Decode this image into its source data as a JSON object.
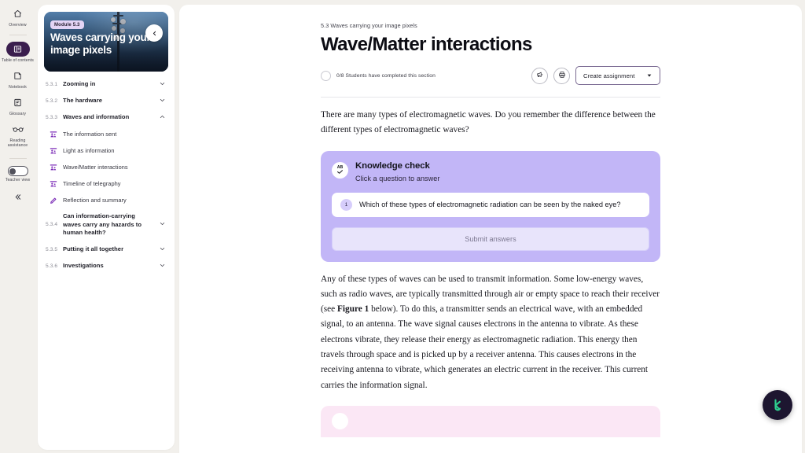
{
  "rail": {
    "items": [
      {
        "label": "Overview",
        "icon": "home-icon",
        "active": false
      },
      {
        "label": "Table of contents",
        "icon": "table-of-contents-icon",
        "active": true
      },
      {
        "label": "Notebook",
        "icon": "notebook-icon",
        "active": false
      },
      {
        "label": "Glossary",
        "icon": "glossary-icon",
        "active": false
      },
      {
        "label": "Reading assistance",
        "icon": "reading-assistance-icon",
        "active": false
      }
    ],
    "teacher_view": {
      "label": "Teacher view",
      "state": "off"
    },
    "collapse": {
      "icon": "chevron-double-left-icon"
    }
  },
  "toc": {
    "hero": {
      "module_chip": "Module 5.3",
      "title": "Waves carrying your image pixels",
      "back_icon": "chevron-left-icon"
    },
    "sections": [
      {
        "number": "5.3.1",
        "label": "Zooming in",
        "chevron": "chevron-down-icon",
        "expanded": false
      },
      {
        "number": "5.3.2",
        "label": "The hardware",
        "chevron": "chevron-down-icon",
        "expanded": false
      },
      {
        "number": "5.3.3",
        "label": "Waves and information",
        "chevron": "chevron-up-icon",
        "expanded": true
      }
    ],
    "sub_items": [
      {
        "label": "The information sent",
        "icon": "presentation-icon"
      },
      {
        "label": "Light as information",
        "icon": "presentation-icon"
      },
      {
        "label": "Wave/Matter interactions",
        "icon": "presentation-icon"
      },
      {
        "label": "Timeline of telegraphy",
        "icon": "presentation-icon"
      },
      {
        "label": "Reflection and summary",
        "icon": "pencil-icon"
      }
    ],
    "sections_after": [
      {
        "number": "5.3.4",
        "label": "Can information-carrying waves carry any hazards to human health?",
        "chevron": "chevron-down-icon"
      },
      {
        "number": "5.3.5",
        "label": "Putting it all together",
        "chevron": "chevron-down-icon"
      },
      {
        "number": "5.3.6",
        "label": "Investigations",
        "chevron": "chevron-down-icon"
      }
    ]
  },
  "header": {
    "breadcrumb": "5.3 Waves carrying your image pixels",
    "title": "Wave/Matter interactions",
    "progress_text": "0/8 Students have completed this section",
    "announce_icon": "megaphone-icon",
    "print_icon": "printer-icon",
    "create_assignment_label": "Create assignment",
    "create_assignment_chevron": "chevron-down-icon"
  },
  "content": {
    "paragraph_1": "There are many types of electromagnetic waves. Do you remember the difference between the different types of electromagnetic waves?",
    "paragraph_2_part1": "Any of these types of waves can be used to transmit information. Some low-energy waves, such as radio waves, are typically transmitted through air or empty space to reach their receiver (see ",
    "paragraph_2_bold": "Figure 1",
    "paragraph_2_part2": " below). To do this, a transmitter sends an electrical wave, with an embedded signal, to an antenna. The wave signal causes electrons in the antenna to vibrate. As these electrons vibrate, they release their energy as electromagnetic radiation. This energy then travels through space and is picked up by a receiver antenna. This causes electrons in the receiving antenna to vibrate, which generates an electric current in the receiver. This current carries the information signal."
  },
  "knowledge_check": {
    "badge_text": "AB",
    "badge_icon": "check-icon",
    "title": "Knowledge check",
    "subtitle": "Click a question to answer",
    "questions": [
      {
        "number": "1",
        "text": "Which of these types of electromagnetic radiation can be seen by the naked eye?"
      }
    ],
    "submit_label": "Submit answers"
  },
  "fab": {
    "icon": "kognity-logo-icon",
    "color": "#2ecf8e"
  },
  "colors": {
    "app_background": "#f2f0ec",
    "panel": "#ffffff",
    "accent_purple": "#c2b6f7",
    "rail_active": "#3b1e4e",
    "sub_icon_purple": "#7d2fb8",
    "pink_card": "#fbe7f5"
  }
}
